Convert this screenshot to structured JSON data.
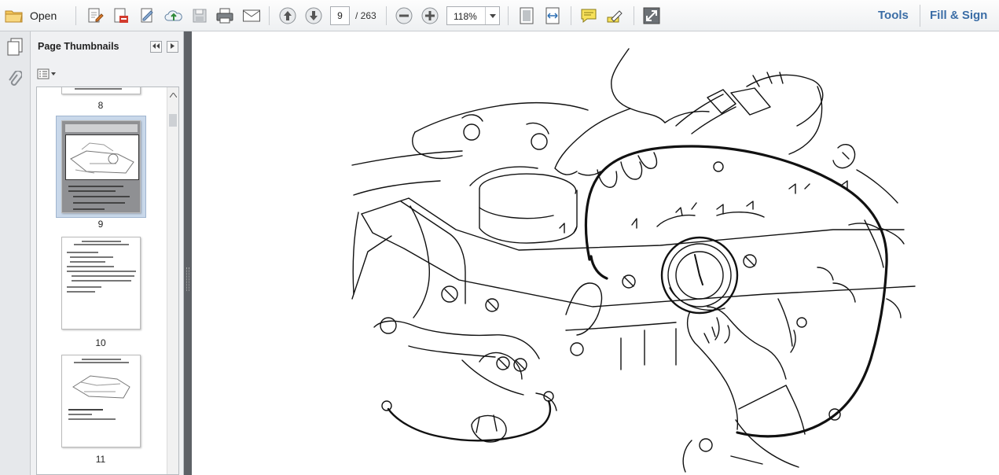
{
  "toolbar": {
    "open_label": "Open",
    "current_page": "9",
    "page_total": "/ 263",
    "zoom": "118%",
    "tools_label": "Tools",
    "fill_sign_label": "Fill & Sign"
  },
  "navigation_pane": {
    "title": "Page Thumbnails",
    "thumbnails": [
      {
        "page": "8",
        "selected": false
      },
      {
        "page": "9",
        "selected": true
      },
      {
        "page": "10",
        "selected": false
      },
      {
        "page": "11",
        "selected": false
      }
    ]
  },
  "colors": {
    "link_blue": "#3b6da6",
    "selection": "#c9d8ea",
    "splitter": "#5e6166"
  },
  "icons": [
    "folder-icon",
    "edit-pdf-icon",
    "create-pdf-icon",
    "sign-icon",
    "cloud-upload-icon",
    "save-icon",
    "print-icon",
    "email-icon",
    "previous-page-icon",
    "next-page-icon",
    "zoom-out-icon",
    "zoom-in-icon",
    "fit-page-icon",
    "fit-width-icon",
    "comment-icon",
    "highlight-icon",
    "fullscreen-icon",
    "thumbnails-icon",
    "attachment-icon"
  ]
}
